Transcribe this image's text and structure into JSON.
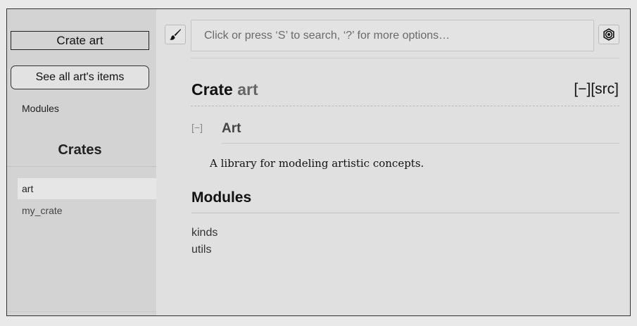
{
  "sidebar": {
    "crate_title": "Crate art",
    "all_items_button": "See all art's items",
    "modules_link": "Modules",
    "crates_heading": "Crates",
    "crates": [
      {
        "label": "art",
        "selected": true
      },
      {
        "label": "my_crate",
        "selected": false
      }
    ]
  },
  "toolbar": {
    "theme_icon": "paintbrush-icon",
    "search_placeholder": "Click or press ‘S’ to search, ‘?’ for more options…",
    "search_value": "",
    "settings_icon": "gear-icon"
  },
  "main": {
    "title_prefix": "Crate ",
    "title_name": "art",
    "collapse_all": "[−]",
    "src": "[src]",
    "section_toggle": "[−]",
    "section_heading": "Art",
    "doc_text": "A library for modeling artistic concepts.",
    "modules_heading": "Modules",
    "modules": [
      "kinds",
      "utils"
    ]
  },
  "colors": {
    "sidebar_bg": "#d3d3d3",
    "main_bg": "#e0e0e0",
    "selected_bg": "#e6e6e6"
  }
}
